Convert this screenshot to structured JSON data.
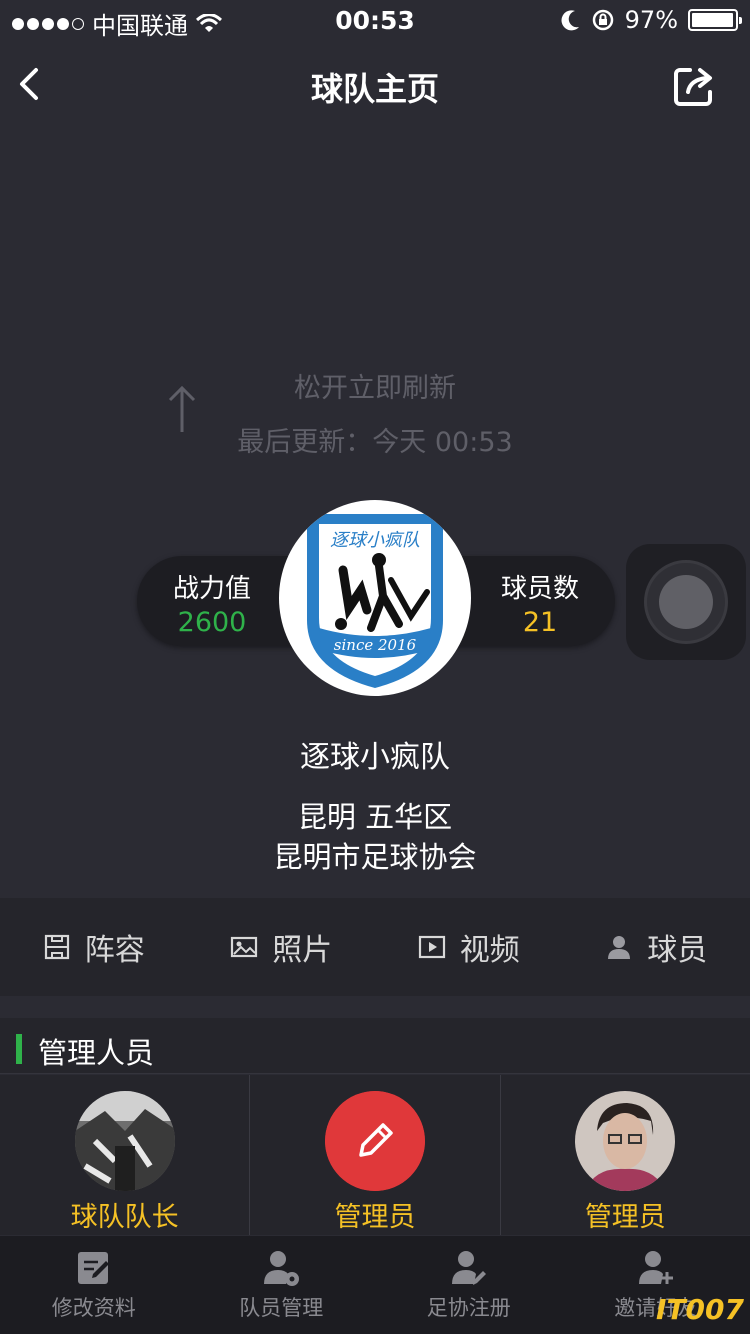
{
  "status": {
    "carrier": "中国联通",
    "time": "00:53",
    "battery": "97%",
    "battery_level": 0.97
  },
  "nav": {
    "title": "球队主页"
  },
  "refresh": {
    "release": "松开立即刷新",
    "last_update": "最后更新：今天 00:53"
  },
  "stats": {
    "power_label": "战力值",
    "power_value": "2600",
    "players_label": "球员数",
    "players_value": "21"
  },
  "logo": {
    "banner": "逐球小疯队",
    "since": "since 2016"
  },
  "team": {
    "name": "逐球小疯队",
    "location": "昆明 五华区",
    "association": "昆明市足球协会"
  },
  "tabs": [
    {
      "label": "阵容",
      "icon": "lineup-icon"
    },
    {
      "label": "照片",
      "icon": "photo-icon"
    },
    {
      "label": "视频",
      "icon": "video-icon"
    },
    {
      "label": "球员",
      "icon": "player-icon"
    }
  ],
  "section": {
    "title": "管理人员"
  },
  "managers": [
    {
      "role": "球队队长"
    },
    {
      "role": "管理员"
    },
    {
      "role": "管理员"
    }
  ],
  "toolbar": [
    {
      "label": "修改资料"
    },
    {
      "label": "队员管理"
    },
    {
      "label": "足协注册"
    },
    {
      "label": "邀请好友"
    }
  ],
  "watermark": "IT007",
  "colors": {
    "accent_green": "#2fb24a",
    "accent_yellow": "#f5c125",
    "edit_red": "#e0383a"
  }
}
